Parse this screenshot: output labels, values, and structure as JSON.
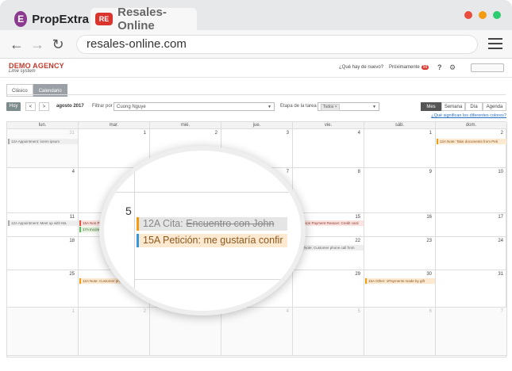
{
  "browser": {
    "tabs": [
      {
        "label": "PropExtra",
        "icon": "E"
      },
      {
        "label": "Resales-Online",
        "icon": "RE"
      }
    ],
    "url": "resales-online.com",
    "window_dots": [
      "#e74c3c",
      "#f39c12",
      "#2ecc71"
    ]
  },
  "app": {
    "logo_main": "DEMO AGENCY",
    "logo_sub": "Lime system",
    "whats_new": "¿Qué hay de nuevo?",
    "coming_soon": "Próximamente",
    "coming_soon_badge": "99",
    "help": "?",
    "view_tabs": [
      "Clásico",
      "Calendario"
    ],
    "toolbar": {
      "today": "Hoy",
      "prev": "<",
      "next": ">",
      "month_label": "agosto 2017",
      "filter_label": "Filtrar por",
      "filter_value": "Cuong Nguye",
      "stage_label": "Etapa de la tarea",
      "stage_chip": "Todos ×",
      "views": [
        "Mes",
        "Semana",
        "Día",
        "Agenda"
      ]
    },
    "legend_link": "¿Qué significan los diferentes colores?"
  },
  "calendar": {
    "weekdays": [
      "lun.",
      "mar.",
      "mié.",
      "jue.",
      "vie.",
      "sáb.",
      "dom."
    ],
    "weeks": [
      {
        "days": [
          "31",
          "1",
          "2",
          "3",
          "4",
          "1",
          "2"
        ],
        "other": [
          true,
          false,
          false,
          false,
          false,
          false,
          false
        ]
      },
      {
        "days": [
          "4",
          "5",
          "6",
          "7",
          "8",
          "9",
          "10"
        ],
        "other": [
          false,
          false,
          false,
          false,
          false,
          false,
          false
        ]
      },
      {
        "days": [
          "11",
          "12",
          "13",
          "14",
          "15",
          "16",
          "17"
        ],
        "other": [
          false,
          false,
          false,
          false,
          false,
          false,
          false
        ]
      },
      {
        "days": [
          "18",
          "19",
          "20",
          "21",
          "22",
          "23",
          "24"
        ],
        "other": [
          false,
          false,
          false,
          false,
          false,
          false,
          false
        ]
      },
      {
        "days": [
          "25",
          "26",
          "27",
          "28",
          "29",
          "30",
          "31"
        ],
        "other": [
          false,
          false,
          false,
          false,
          false,
          false,
          false
        ]
      },
      {
        "days": [
          "1",
          "2",
          "3",
          "4",
          "5",
          "6",
          "7"
        ],
        "other": [
          true,
          true,
          true,
          true,
          true,
          true,
          true
        ]
      }
    ],
    "events": {
      "w0_mon": "12A Appointment: lorem ipsum",
      "w0_sun": "12A Note: Take documents from Peti",
      "w2_mon": "12A Appointment: Meet up with Ma",
      "w2_tue_1": "16A Non Payment Reason",
      "w2_tue_2": "17A Incoming Email: Busine",
      "w2_thu": "n Ma",
      "w2_fri": "16A Non Payment Reason: Credit card",
      "w3_fri": "12A Note: Customer phone call from",
      "w4_tue": "12A Note: Customer phone call from",
      "w4_sat": "15A Other: 1Payments made by gift"
    }
  },
  "magnifier": {
    "day_number": "5",
    "event1_time": "12A Cita:",
    "event1_text": "Encuentro con John",
    "event2_time": "15A Petición:",
    "event2_text": "me gustaría confir"
  }
}
